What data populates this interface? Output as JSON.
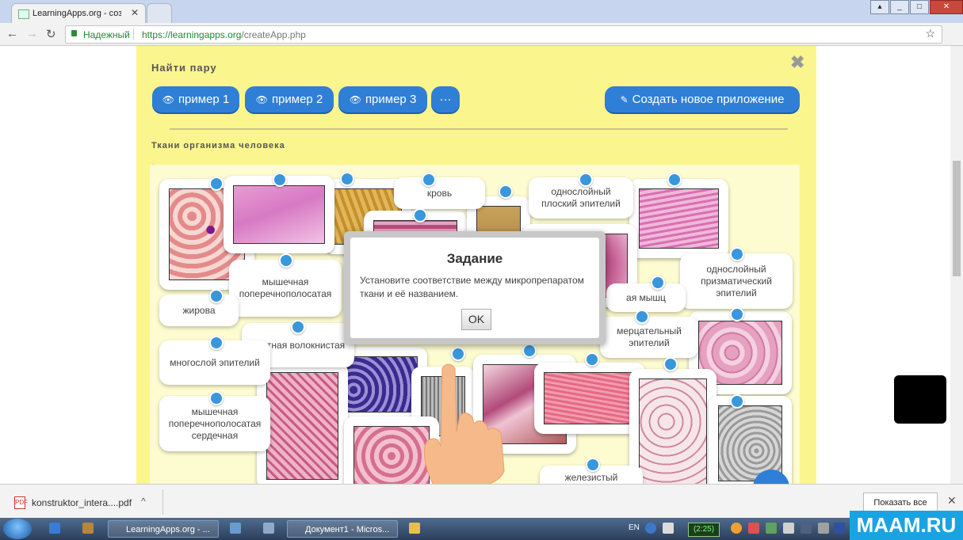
{
  "browser": {
    "tab_title": "LearningApps.org - созд",
    "secure_label": "Надежный",
    "url_scheme_host": "https://learningapps.org",
    "url_path": "/createApp.php"
  },
  "panel": {
    "title": "Найти пару",
    "buttons": [
      {
        "label": "пример 1"
      },
      {
        "label": "пример 2"
      },
      {
        "label": "пример 3"
      },
      {
        "label": "···"
      }
    ],
    "create_button": "Создать новое приложение",
    "subtitle": "Ткани организма человека"
  },
  "labels": [
    {
      "text": "кровь"
    },
    {
      "text": "однослойный плоский эпителий"
    },
    {
      "text": "однослойный призматический эпителий"
    },
    {
      "text": "мышечная поперечнополосатая"
    },
    {
      "text": "жирова"
    },
    {
      "text": "плотная волокнистая"
    },
    {
      "text": "многослой эпителий"
    },
    {
      "text": "мышечная поперечнополосатая сердечная"
    },
    {
      "text": "ая мышц"
    },
    {
      "text": "мерцательный эпителий"
    },
    {
      "text": "железистый"
    }
  ],
  "dialog": {
    "title": "Задание",
    "text": "Установите соответствие между микропрепаратом ткани и её названием.",
    "ok": "OK"
  },
  "download": {
    "file": "konstruktor_intera....pdf",
    "show_all": "Показать все"
  },
  "taskbar": {
    "items": [
      {
        "label": "LearningApps.org - ..."
      },
      {
        "label": "Документ1 - Micros..."
      }
    ],
    "lang": "EN",
    "clock": "(2:25)"
  },
  "watermark": "MAAM.RU",
  "colors": {
    "panel_bg": "#fbf58e",
    "button_blue": "#2f7fd6",
    "pin_blue": "#3a97db",
    "secure_green": "#1e8a35"
  }
}
